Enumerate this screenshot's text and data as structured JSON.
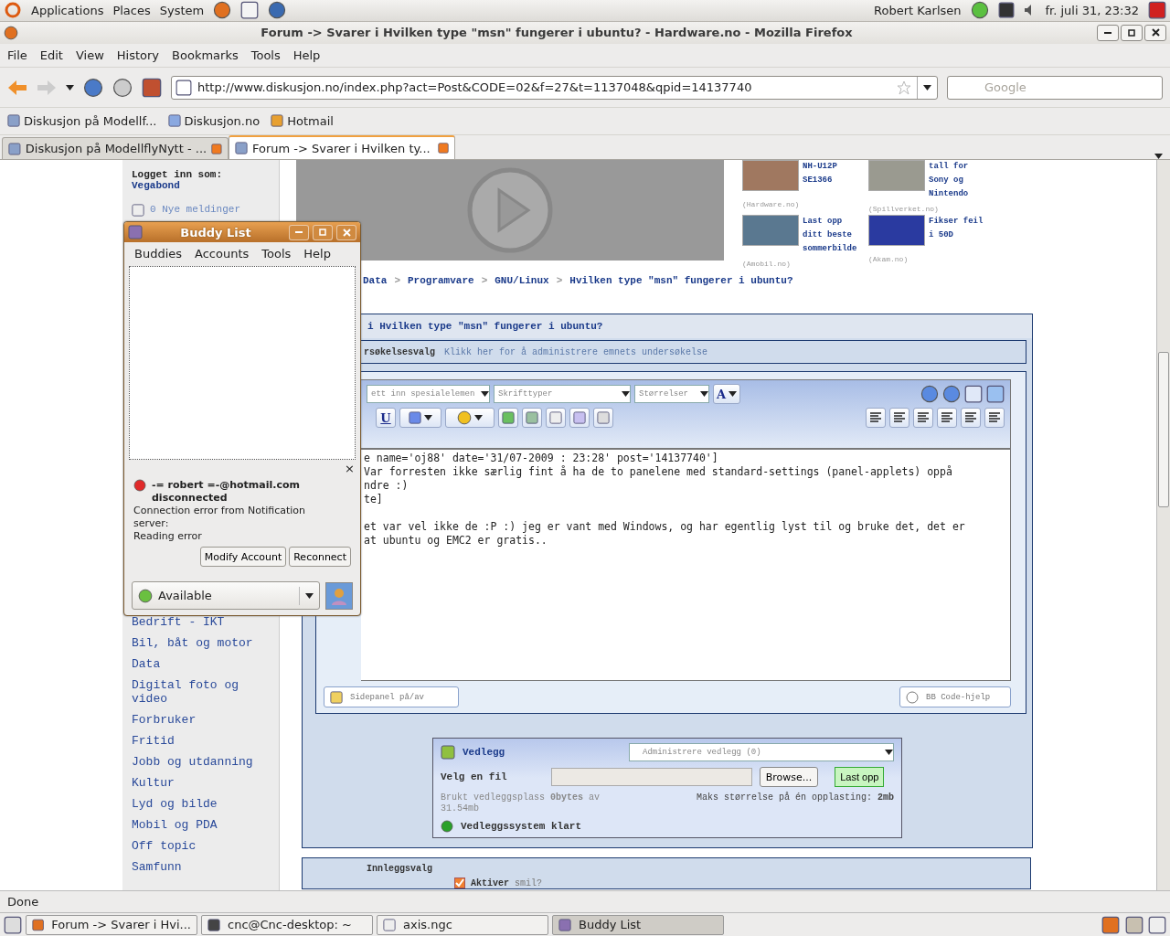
{
  "top_panel": {
    "menus": [
      "Applications",
      "Places",
      "System"
    ],
    "user": "Robert Karlsen",
    "clock": "fr. juli 31, 23:32"
  },
  "window": {
    "title": "Forum -> Svarer i Hvilken type \"msn\" fungerer i ubuntu? - Hardware.no - Mozilla Firefox"
  },
  "menu": [
    "File",
    "Edit",
    "View",
    "History",
    "Bookmarks",
    "Tools",
    "Help"
  ],
  "url": "http://www.diskusjon.no/index.php?act=Post&CODE=02&f=27&t=1137048&qpid=14137740",
  "search": {
    "placeholder": "Google"
  },
  "bookmarks": [
    "Diskusjon på Modellf...",
    "Diskusjon.no",
    "Hotmail"
  ],
  "tabs": [
    {
      "label": "Diskusjon på ModellflyNytt - ...",
      "selected": false
    },
    {
      "label": "Forum -> Svarer i Hvilken ty...",
      "selected": true
    }
  ],
  "sidebar": {
    "logged_in_label": "Logget inn som:",
    "user": "Vegabond",
    "messages": "0 Nye meldinger",
    "categories": [
      "Bedrift - IKT",
      "Bil, båt og motor",
      "Data",
      "Digital foto og video",
      "Forbruker",
      "Fritid",
      "Jobb og utdanning",
      "Kultur",
      "Lyd og bilde",
      "Mobil og PDA",
      "Off topic",
      "Samfunn"
    ]
  },
  "news": [
    {
      "title": "NH-U12P SE1366",
      "source": "(Hardware.no)"
    },
    {
      "title": "tall for Sony og Nintendo",
      "source": "(Spillverket.no)"
    },
    {
      "title": "Last opp ditt beste sommerbilde",
      "source": "(Amobil.no)"
    },
    {
      "title": "Fikser feil i 50D",
      "source": "(Akam.no)"
    }
  ],
  "breadcrumb": {
    "separator": ">",
    "items": [
      "Data",
      "Programvare",
      "GNU/Linux",
      "Hvilken type \"msn\" fungerer i ubuntu?"
    ]
  },
  "form": {
    "title": "i Hvilken type \"msn\" fungerer i ubuntu?",
    "survey_label": "rsøkelsesvalg",
    "survey_link": "Klikk her for å administrere emnets undersøkelse",
    "selects": [
      "ett inn spesialelemen",
      "Skrifttyper",
      "Størrelser"
    ],
    "color_button": "A",
    "underline_button": "U",
    "editor_lines": [
      "e name='oj88' date='31/07-2009 : 23:28' post='14137740']",
      "Var forresten ikke særlig fint å ha de to panelene med standard-settings (panel-applets) oppå",
      "ndre :)",
      "te]",
      "et var vel ikke de :P :) jeg er vant med Windows, og har egentlig lyst til og bruke det, det er",
      "at ubuntu og EMC2 er gratis.."
    ],
    "sidepanel_button": "Sidepanel på/av",
    "bbcode_button": "BB Code-hjelp"
  },
  "attachments": {
    "title": "Vedlegg",
    "manage_select": "Administrere vedlegg (0)",
    "file_label": "Velg en fil",
    "browse_button": "Browse...",
    "upload_button": "Last opp",
    "usage": "Brukt vedleggsplass **0bytes** av 31.54mb",
    "max_size": "Maks størrelse på én opplasting: **2mb**",
    "status": "Vedleggssystem klart"
  },
  "post_options": {
    "title": "Innleggsvalg",
    "smilies": {
      "label": "**Aktiver** smil?",
      "checked": true
    }
  },
  "status": "Done",
  "taskbar": [
    {
      "label": "Forum -> Svarer i Hvi...",
      "selected": false
    },
    {
      "label": "cnc@Cnc-desktop: ~",
      "selected": false
    },
    {
      "label": "axis.ngc",
      "selected": false
    },
    {
      "label": "Buddy List",
      "selected": true
    }
  ],
  "buddy_list": {
    "title": "Buddy List",
    "menu": [
      "Buddies",
      "Accounts",
      "Tools",
      "Help"
    ],
    "close_notice": "×",
    "account": "-= robert =-@hotmail.com",
    "state": "disconnected",
    "error_lines": [
      "Connection error from Notification server:",
      "Reading error"
    ],
    "buttons": [
      "Modify Account",
      "Reconnect"
    ],
    "status": "Available"
  }
}
